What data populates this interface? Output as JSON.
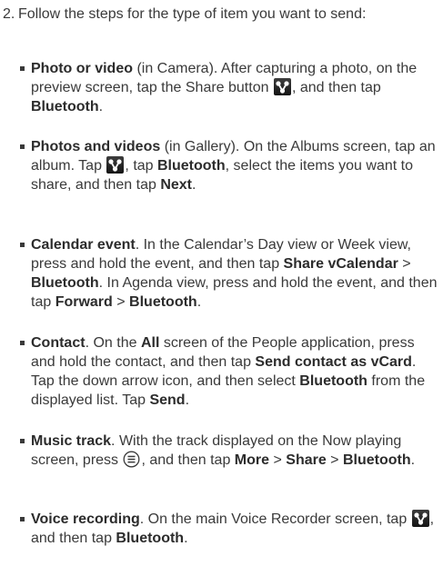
{
  "step": {
    "number": "2.",
    "intro": "Follow the steps for the type of item you want to send:"
  },
  "items": {
    "photo": {
      "title": "Photo or video",
      "t1": " (in Camera). After capturing a photo, on the preview screen, tap the Share button ",
      "t2": ", and then tap ",
      "bluetooth": "Bluetooth",
      "t3": "."
    },
    "photos": {
      "title": "Photos and videos",
      "t1": " (in Gallery). On the Albums screen, tap an album. Tap ",
      "t2": ", tap ",
      "bluetooth": "Bluetooth",
      "t3": ", select the items you want to share, and then tap ",
      "next": "Next",
      "t4": "."
    },
    "calendar": {
      "title": "Calendar event",
      "t1": ". In the Calendar’s Day view or Week view, press and hold the event, and then tap ",
      "share": "Share vCalendar",
      "gt1": " > ",
      "bluetooth1": "Bluetooth",
      "t2": ". In Agenda view, press and hold the event, and then tap ",
      "forward": "Forward",
      "gt2": " > ",
      "bluetooth2": "Bluetooth",
      "t3": "."
    },
    "contact": {
      "title": "Contact",
      "t1": ". On the ",
      "all": "All",
      "t2": " screen of the People application, press and hold the contact, and then tap ",
      "send_vcard": "Send contact as vCard",
      "t3": ". Tap the down arrow icon, and then select ",
      "bluetooth": "Bluetooth",
      "t4": " from the displayed list. Tap ",
      "send": "Send",
      "t5": "."
    },
    "music": {
      "title": "Music track",
      "t1": ". With the track displayed on the Now playing screen, press ",
      "t2": ", and then tap ",
      "more": "More",
      "gt1": " > ",
      "share": "Share",
      "gt2": " > ",
      "bluetooth": "Bluetooth",
      "t3": "."
    },
    "voice": {
      "title": "Voice recording",
      "t1": ". On the main Voice Recorder screen, tap ",
      "t2": ", and then tap ",
      "bluetooth": "Bluetooth",
      "t3": "."
    }
  },
  "icons": {
    "share": "share-icon",
    "menu": "menu-icon"
  }
}
